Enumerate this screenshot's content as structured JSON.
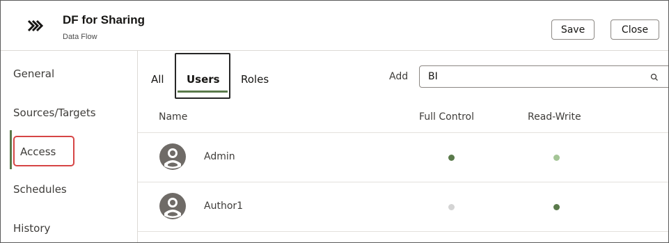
{
  "header": {
    "title": "DF for Sharing",
    "subtitle": "Data Flow",
    "save_label": "Save",
    "close_label": "Close",
    "icon": "data-flow-chevrons-icon"
  },
  "sidebar": {
    "items": [
      {
        "label": "General",
        "active": false
      },
      {
        "label": "Sources/Targets",
        "active": false
      },
      {
        "label": "Access",
        "active": true
      },
      {
        "label": "Schedules",
        "active": false
      },
      {
        "label": "History",
        "active": false
      }
    ]
  },
  "tabs": [
    {
      "label": "All",
      "selected": false
    },
    {
      "label": "Users",
      "selected": true
    },
    {
      "label": "Roles",
      "selected": false
    }
  ],
  "search": {
    "add_label": "Add",
    "value": "BI"
  },
  "table": {
    "columns": [
      "Name",
      "Full Control",
      "Read-Write"
    ],
    "rows": [
      {
        "name": "Admin",
        "full_control": "dark",
        "read_write": "light"
      },
      {
        "name": "Author1",
        "full_control": "off",
        "read_write": "dark"
      }
    ]
  },
  "colors": {
    "accent": "#5a7a4b",
    "dot_dark": "#5a7a4b",
    "dot_light": "#a4c596",
    "dot_off": "#d4d4d4",
    "highlight": "#d64545"
  }
}
